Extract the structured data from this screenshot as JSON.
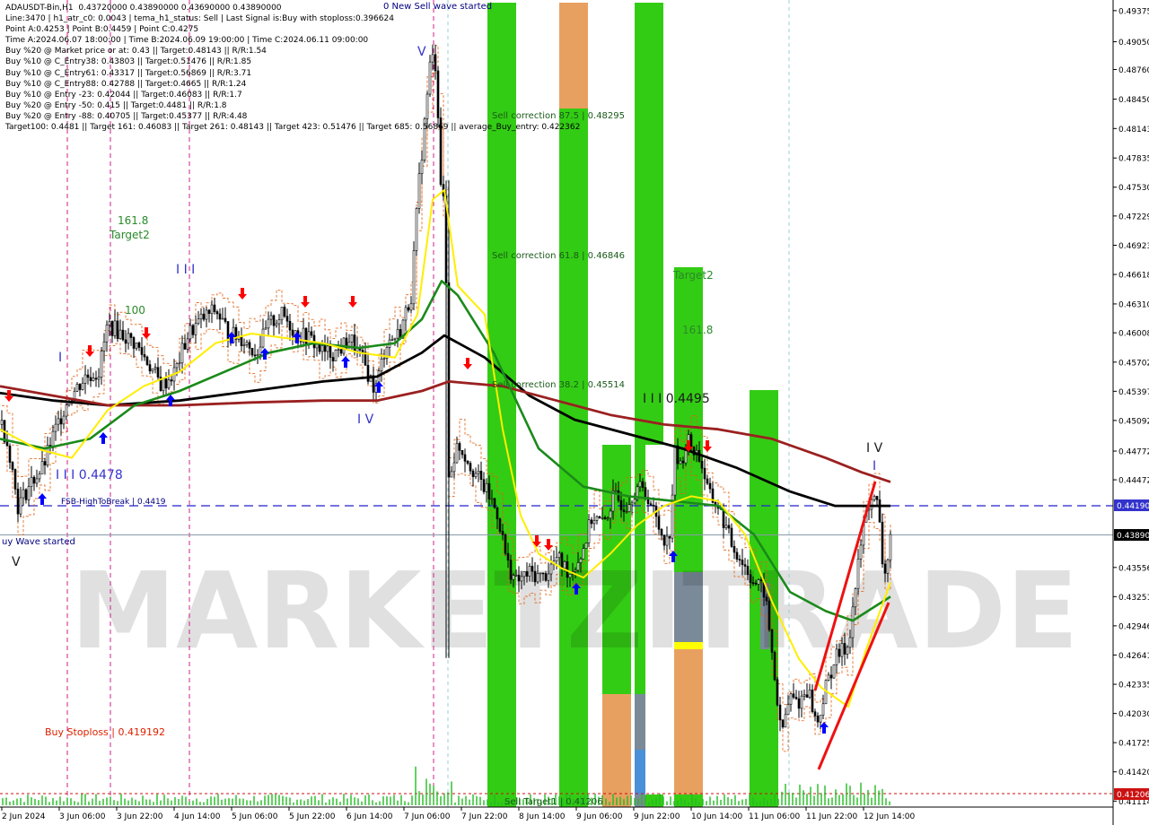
{
  "info_lines": [
    "ADAUSDT-Bin,H1  0.43720000 0.43890000 0.43690000 0.43890000",
    "Line:3470 | h1_atr_c0: 0.0043 | tema_h1_status: Sell | Last Signal is:Buy with stoploss:0.396624",
    "Point A:0.4253 | Point B:0.4459 | Point C:0.4275",
    "Time A:2024.06.07 18:00:00 | Time B:2024.06.09 19:00:00 | Time C:2024.06.11 09:00:00",
    "Buy %20 @ Market price or at: 0.43 || Target:0.48143 || R/R:1.54",
    "Buy %10 @ C_Entry38: 0.43803 || Target:0.51476 || R/R:1.85",
    "Buy %10 @ C_Entry61: 0.43317 || Target:0.56869 || R/R:3.71",
    "Buy %10 @ C_Entry88: 0.42788 || Target:0.4665 || R/R:1.24",
    "Buy %10 @ Entry -23: 0.42044 || Target:0.46083 || R/R:1.7",
    "Buy %20 @ Entry -50: 0.415 || Target:0.4481 || R/R:1.8",
    "Buy %20 @ Entry -88: 0.40705 || Target:0.45377 || R/R:4.48",
    "Target100: 0.4481 || Target 161: 0.46083 || Target 261: 0.48143 || Target 423: 0.51476 || Target 685: 0.56869 || average_Buy_entry: 0.422362"
  ],
  "annotations": {
    "new_sell_wave": "0 New Sell wave started",
    "buy_wave_started": "uy Wave started",
    "sell_corr_875": "Sell correction 87.5 | 0.48295",
    "sell_corr_618": "Sell correction 61.8 | 0.46846",
    "sell_corr_382": "Sell correction 38.2 | 0.45514",
    "sell_target1": "Sell Target1 | 0.41206",
    "fsb": "FSB-HighToBreak | 0.4419",
    "buy_stoploss": "Buy Stoploss | 0.419192",
    "level_4478": "I I I 0.4478",
    "level_4495": "I I I 0.4495",
    "label_1618_left": "161.8",
    "label_target2_left": "Target2",
    "label_100": "100",
    "label_target2_right": "Target2",
    "label_1618_right": "161.8",
    "wave_III": "I I I",
    "wave_IV_left": "I V",
    "wave_V_top": "V",
    "wave_V_left": "V",
    "wave_IV_right": "I V",
    "wave_I_right": "I",
    "wave_I_left": "I",
    "watermark": "MARKETZITRADE"
  },
  "price_axis": {
    "ticks": [
      "0.49375",
      "0.49050",
      "0.48760",
      "0.48450",
      "0.48143",
      "0.47835",
      "0.47530",
      "0.47229",
      "0.46923",
      "0.46618",
      "0.46310",
      "0.46008",
      "0.45702",
      "0.45397",
      "0.45092",
      "0.44772",
      "0.44472",
      "0.43556",
      "0.43251",
      "0.42946",
      "0.42641",
      "0.42335",
      "0.42030",
      "0.41725",
      "0.41420",
      "0.41114"
    ],
    "tag_fsb": "0.44190",
    "tag_current": "0.43890",
    "tag_target": "0.41206"
  },
  "time_axis": [
    "2 Jun 2024",
    "3 Jun 06:00",
    "3 Jun 22:00",
    "4 Jun 14:00",
    "5 Jun 06:00",
    "5 Jun 22:00",
    "6 Jun 14:00",
    "7 Jun 06:00",
    "7 Jun 22:00",
    "8 Jun 14:00",
    "9 Jun 06:00",
    "9 Jun 22:00",
    "10 Jun 14:00",
    "11 Jun 06:00",
    "11 Jun 22:00",
    "12 Jun 14:00"
  ],
  "colors": {
    "green_zone": "#33cc14",
    "orange_zone": "#e8a060",
    "gray_zone": "#7a8a99",
    "blue_zone": "#4a90d9",
    "yellow_zone": "#ffff00",
    "ma_black": "#000000",
    "ma_brown": "#9b2020",
    "ma_green": "#1a8a1a",
    "ma_yellow": "#ffee00",
    "candles": "#000000",
    "arrow_up": "#0000ff",
    "arrow_down": "#ff0000"
  },
  "chart_data": {
    "type": "candlestick",
    "symbol": "ADAUSDT-Bin",
    "timeframe": "H1",
    "ohlc_last": {
      "open": 0.4372,
      "high": 0.4389,
      "low": 0.4369,
      "close": 0.4389
    },
    "ylim": [
      0.4108,
      0.4943
    ],
    "levels": {
      "fsb_high_to_break": 0.4419,
      "sell_target1": 0.41206,
      "buy_stoploss": 0.419192,
      "current": 0.4389,
      "wave_4478": 0.4478,
      "wave_4495": 0.4495
    },
    "close_path": [
      [
        2,
        0.4505
      ],
      [
        10,
        0.448
      ],
      [
        20,
        0.442
      ],
      [
        35,
        0.4445
      ],
      [
        48,
        0.446
      ],
      [
        60,
        0.4495
      ],
      [
        75,
        0.453
      ],
      [
        95,
        0.4555
      ],
      [
        110,
        0.456
      ],
      [
        120,
        0.461
      ],
      [
        135,
        0.46
      ],
      [
        150,
        0.459
      ],
      [
        165,
        0.457
      ],
      [
        180,
        0.4545
      ],
      [
        195,
        0.456
      ],
      [
        210,
        0.46
      ],
      [
        225,
        0.4615
      ],
      [
        240,
        0.4625
      ],
      [
        255,
        0.46
      ],
      [
        270,
        0.4595
      ],
      [
        285,
        0.458
      ],
      [
        300,
        0.461
      ],
      [
        315,
        0.462
      ],
      [
        330,
        0.46
      ],
      [
        345,
        0.4595
      ],
      [
        360,
        0.458
      ],
      [
        375,
        0.458
      ],
      [
        390,
        0.4595
      ],
      [
        405,
        0.457
      ],
      [
        418,
        0.454
      ],
      [
        430,
        0.459
      ],
      [
        445,
        0.46
      ],
      [
        458,
        0.464
      ],
      [
        466,
        0.475
      ],
      [
        473,
        0.482
      ],
      [
        480,
        0.489
      ],
      [
        486,
        0.488
      ],
      [
        491,
        0.476
      ],
      [
        496,
        0.472
      ],
      [
        500,
        0.445
      ],
      [
        510,
        0.4485
      ],
      [
        520,
        0.447
      ],
      [
        532,
        0.445
      ],
      [
        545,
        0.443
      ],
      [
        555,
        0.441
      ],
      [
        565,
        0.436
      ],
      [
        575,
        0.434
      ],
      [
        590,
        0.435
      ],
      [
        605,
        0.4345
      ],
      [
        620,
        0.4365
      ],
      [
        635,
        0.435
      ],
      [
        648,
        0.437
      ],
      [
        660,
        0.441
      ],
      [
        672,
        0.44
      ],
      [
        684,
        0.443
      ],
      [
        696,
        0.442
      ],
      [
        710,
        0.444
      ],
      [
        722,
        0.443
      ],
      [
        735,
        0.4395
      ],
      [
        745,
        0.438
      ],
      [
        752,
        0.4475
      ],
      [
        758,
        0.446
      ],
      [
        765,
        0.449
      ],
      [
        772,
        0.448
      ],
      [
        780,
        0.447
      ],
      [
        790,
        0.443
      ],
      [
        800,
        0.442
      ],
      [
        815,
        0.438
      ],
      [
        828,
        0.436
      ],
      [
        840,
        0.434
      ],
      [
        852,
        0.433
      ],
      [
        862,
        0.425
      ],
      [
        870,
        0.418
      ],
      [
        880,
        0.422
      ],
      [
        890,
        0.4215
      ],
      [
        900,
        0.423
      ],
      [
        910,
        0.419
      ],
      [
        920,
        0.423
      ],
      [
        930,
        0.426
      ],
      [
        945,
        0.4275
      ],
      [
        955,
        0.435
      ],
      [
        962,
        0.44
      ],
      [
        970,
        0.443
      ],
      [
        978,
        0.442
      ],
      [
        985,
        0.434
      ],
      [
        992,
        0.4389
      ]
    ],
    "indicators": [
      {
        "name": "MA black",
        "color": "#000000",
        "points": [
          [
            0,
            0.4538
          ],
          [
            60,
            0.453
          ],
          [
            120,
            0.4525
          ],
          [
            200,
            0.453
          ],
          [
            280,
            0.454
          ],
          [
            360,
            0.455
          ],
          [
            420,
            0.4555
          ],
          [
            470,
            0.458
          ],
          [
            495,
            0.4598
          ],
          [
            540,
            0.4575
          ],
          [
            590,
            0.4535
          ],
          [
            640,
            0.451
          ],
          [
            700,
            0.4495
          ],
          [
            760,
            0.448
          ],
          [
            820,
            0.446
          ],
          [
            880,
            0.4435
          ],
          [
            930,
            0.442
          ],
          [
            960,
            0.442
          ],
          [
            992,
            0.442
          ]
        ]
      },
      {
        "name": "MA brown",
        "color": "#9b2020",
        "points": [
          [
            0,
            0.4545
          ],
          [
            60,
            0.4535
          ],
          [
            120,
            0.4525
          ],
          [
            200,
            0.4525
          ],
          [
            280,
            0.4528
          ],
          [
            360,
            0.453
          ],
          [
            420,
            0.453
          ],
          [
            470,
            0.454
          ],
          [
            500,
            0.455
          ],
          [
            560,
            0.4545
          ],
          [
            620,
            0.453
          ],
          [
            680,
            0.4515
          ],
          [
            740,
            0.4505
          ],
          [
            800,
            0.45
          ],
          [
            860,
            0.449
          ],
          [
            920,
            0.447
          ],
          [
            960,
            0.4455
          ],
          [
            992,
            0.4445
          ]
        ]
      },
      {
        "name": "MA green",
        "color": "#1a8a1a",
        "points": [
          [
            0,
            0.449
          ],
          [
            50,
            0.448
          ],
          [
            100,
            0.449
          ],
          [
            150,
            0.4525
          ],
          [
            200,
            0.454
          ],
          [
            250,
            0.456
          ],
          [
            300,
            0.458
          ],
          [
            350,
            0.459
          ],
          [
            400,
            0.4585
          ],
          [
            440,
            0.459
          ],
          [
            470,
            0.4615
          ],
          [
            492,
            0.4655
          ],
          [
            510,
            0.464
          ],
          [
            550,
            0.458
          ],
          [
            600,
            0.448
          ],
          [
            650,
            0.444
          ],
          [
            700,
            0.443
          ],
          [
            750,
            0.4425
          ],
          [
            800,
            0.442
          ],
          [
            840,
            0.439
          ],
          [
            880,
            0.433
          ],
          [
            920,
            0.431
          ],
          [
            950,
            0.43
          ],
          [
            975,
            0.4315
          ],
          [
            992,
            0.4325
          ]
        ]
      },
      {
        "name": "MA yellow",
        "color": "#ffee00",
        "points": [
          [
            0,
            0.45
          ],
          [
            40,
            0.448
          ],
          [
            80,
            0.447
          ],
          [
            120,
            0.452
          ],
          [
            160,
            0.4545
          ],
          [
            200,
            0.456
          ],
          [
            240,
            0.459
          ],
          [
            280,
            0.46
          ],
          [
            320,
            0.4595
          ],
          [
            360,
            0.459
          ],
          [
            400,
            0.458
          ],
          [
            440,
            0.4575
          ],
          [
            465,
            0.462
          ],
          [
            482,
            0.474
          ],
          [
            495,
            0.475
          ],
          [
            510,
            0.465
          ],
          [
            540,
            0.462
          ],
          [
            560,
            0.45
          ],
          [
            580,
            0.441
          ],
          [
            600,
            0.437
          ],
          [
            625,
            0.4355
          ],
          [
            650,
            0.4345
          ],
          [
            680,
            0.437
          ],
          [
            710,
            0.44
          ],
          [
            740,
            0.442
          ],
          [
            770,
            0.443
          ],
          [
            800,
            0.4425
          ],
          [
            830,
            0.439
          ],
          [
            860,
            0.432
          ],
          [
            890,
            0.426
          ],
          [
            915,
            0.423
          ],
          [
            945,
            0.421
          ],
          [
            965,
            0.427
          ],
          [
            992,
            0.434
          ]
        ]
      }
    ]
  }
}
